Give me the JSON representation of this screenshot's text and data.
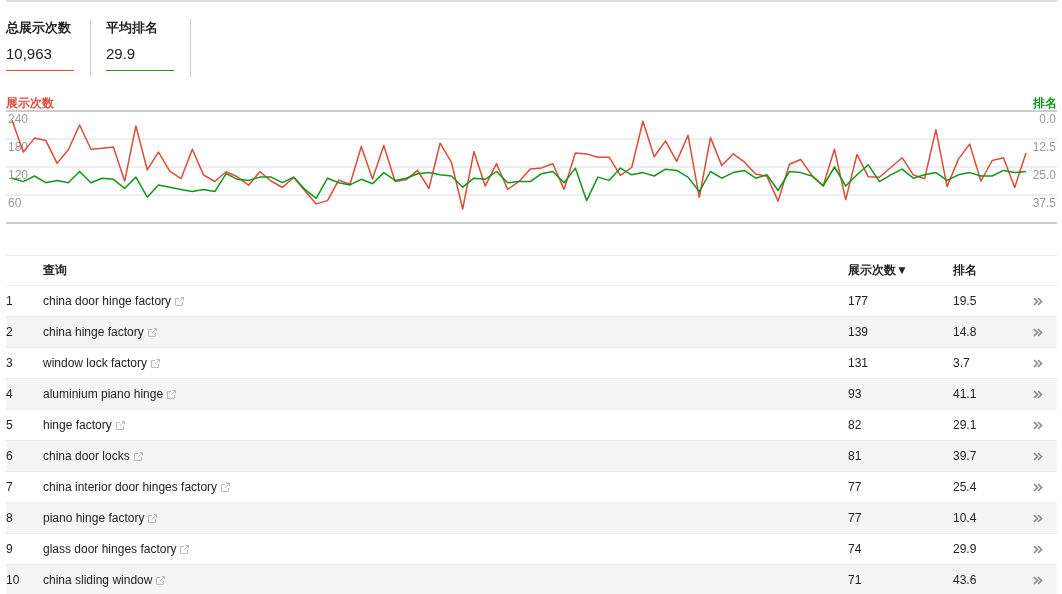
{
  "summary": [
    {
      "label": "总展示次数",
      "value": "10,963",
      "color": "#dd4b39"
    },
    {
      "label": "平均排名",
      "value": "29.9",
      "color": "#109618"
    }
  ],
  "chart": {
    "chart_data": {
      "type": "line",
      "grid": true,
      "ylim": [
        0,
        240
      ],
      "yticks": [
        60,
        120,
        180,
        240
      ],
      "y2lim": [
        50,
        0
      ],
      "y2ticks": [
        {
          "value": 0,
          "label": "0.0"
        },
        {
          "value": 12.5,
          "label": "12.5"
        },
        {
          "value": 25,
          "label": "25.0"
        },
        {
          "value": 37.5,
          "label": "37.5"
        }
      ],
      "series": [
        {
          "name": "展示次数",
          "color": "#dd4b39",
          "values": [
            220,
            152,
            182,
            177,
            128,
            157,
            210,
            158,
            160,
            163,
            90,
            208,
            114,
            152,
            111,
            95,
            158,
            103,
            89,
            110,
            99,
            81,
            110,
            90,
            76,
            98,
            69,
            41,
            48,
            92,
            83,
            164,
            94,
            166,
            89,
            93,
            113,
            74,
            171,
            130,
            30,
            153,
            79,
            127,
            72,
            89,
            116,
            118,
            127,
            72,
            150,
            148,
            141,
            141,
            102,
            119,
            218,
            142,
            176,
            132,
            188,
            55,
            183,
            123,
            148,
            131,
            105,
            100,
            47,
            126,
            136,
            102,
            80,
            158,
            50,
            147,
            99,
            98,
            119,
            140,
            103,
            95,
            200,
            78,
            137,
            169,
            90,
            134,
            140,
            76,
            150
          ]
        },
        {
          "name": "排名",
          "color": "#109618",
          "axis": "y2",
          "values": [
            30,
            31.5,
            29,
            32,
            31,
            32,
            27,
            32,
            30,
            30.5,
            34.5,
            29.5,
            38.5,
            33,
            34,
            35,
            36,
            35,
            36,
            28,
            30.5,
            31,
            29.5,
            29.5,
            32,
            29.5,
            35,
            39,
            30,
            32,
            33,
            30.5,
            32.5,
            27.5,
            31,
            30,
            28,
            27.5,
            28.5,
            29,
            34,
            30,
            30.5,
            27,
            32,
            31.5,
            31.5,
            28,
            27,
            32,
            25.5,
            40,
            29.5,
            31,
            25.5,
            28.5,
            27.5,
            29,
            26,
            26.5,
            29.5,
            36,
            27,
            30,
            27.5,
            26.5,
            30,
            28.5,
            35.5,
            27,
            27.5,
            29,
            33.5,
            25,
            33.5,
            28.5,
            24,
            31.5,
            28.5,
            26,
            30,
            28.5,
            27.5,
            31,
            28.5,
            27.5,
            29,
            29,
            26.5,
            27.5,
            27
          ]
        }
      ]
    }
  },
  "table": {
    "columns": [
      "查询",
      "展示次数▼",
      "排名"
    ],
    "rows": [
      {
        "index": "1",
        "query": "china door hinge factory",
        "impressions": "177",
        "rank": "19.5"
      },
      {
        "index": "2",
        "query": "china hinge factory",
        "impressions": "139",
        "rank": "14.8"
      },
      {
        "index": "3",
        "query": "window lock factory",
        "impressions": "131",
        "rank": "3.7"
      },
      {
        "index": "4",
        "query": "aluminium piano hinge",
        "impressions": "93",
        "rank": "41.1"
      },
      {
        "index": "5",
        "query": "hinge factory",
        "impressions": "82",
        "rank": "29.1"
      },
      {
        "index": "6",
        "query": "china door locks",
        "impressions": "81",
        "rank": "39.7"
      },
      {
        "index": "7",
        "query": "china interior door hinges factory",
        "impressions": "77",
        "rank": "25.4"
      },
      {
        "index": "8",
        "query": "piano hinge factory",
        "impressions": "77",
        "rank": "10.4"
      },
      {
        "index": "9",
        "query": "glass door hinges factory",
        "impressions": "74",
        "rank": "29.9"
      },
      {
        "index": "10",
        "query": "china sliding window",
        "impressions": "71",
        "rank": "43.6"
      }
    ]
  }
}
